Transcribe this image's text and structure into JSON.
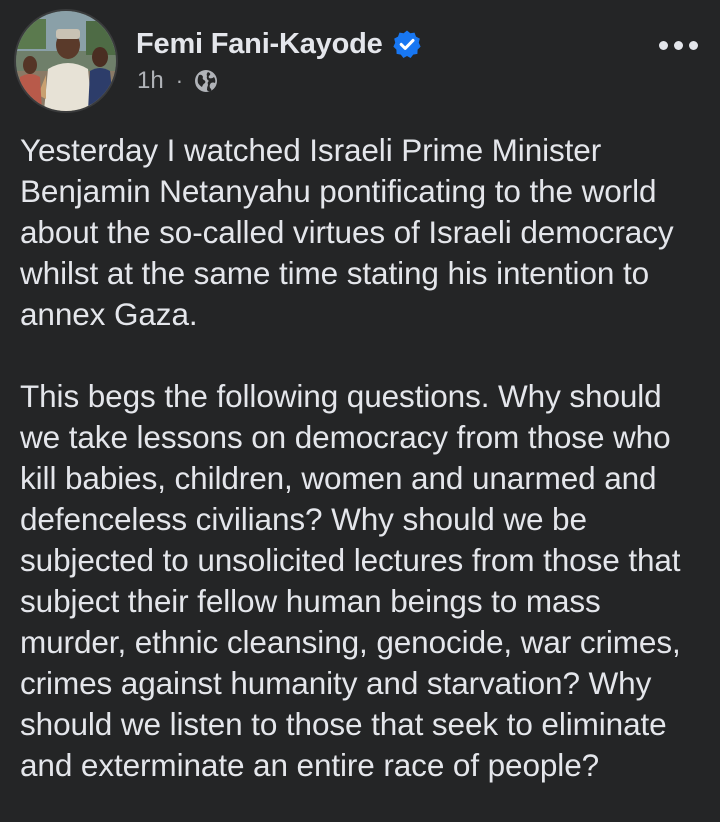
{
  "post": {
    "author": {
      "name": "Femi Fani-Kayode",
      "verified": true,
      "avatar_icon": "profile-photo"
    },
    "time": "1h",
    "separator": "·",
    "audience_icon": "globe-icon",
    "more_icon": "more-options-icon",
    "paragraphs": [
      "Yesterday I watched Israeli Prime Minister Benjamin Netanyahu pontificating to the world about the so-called virtues of Israeli democracy whilst at the same time stating his intention to annex Gaza.",
      "This begs the following questions.  Why should we take lessons on democracy from those who kill babies, children, women and unarmed and defenceless civilians? Why should we be subjected to unsolicited lectures from those that subject their fellow human beings to mass murder, ethnic cleansing, genocide, war crimes, crimes against humanity and starvation? Why should we listen to those that seek to eliminate and exterminate an entire race of people?"
    ]
  },
  "colors": {
    "background": "#242526",
    "primary_text": "#e4e6eb",
    "secondary_text": "#b0b3b8",
    "verified_blue": "#1877f2"
  }
}
